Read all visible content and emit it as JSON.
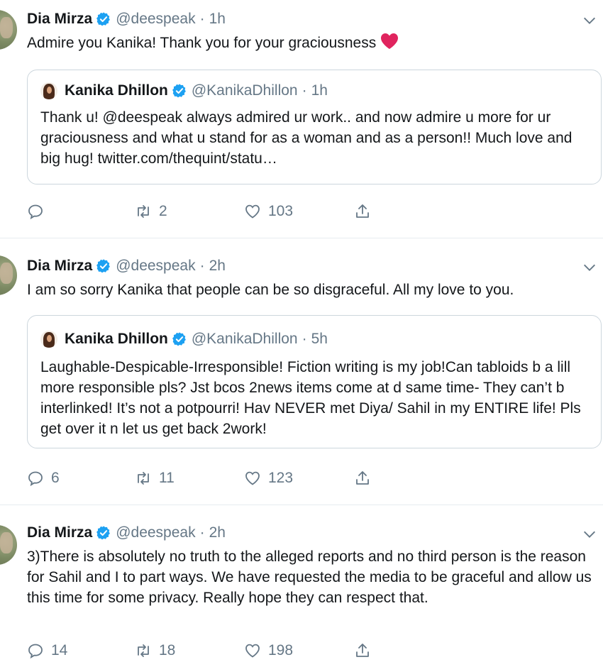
{
  "tweets": [
    {
      "author": {
        "name": "Dia Mirza",
        "handle": "@deespeak"
      },
      "time": "1h",
      "text": "Admire you Kanika! Thank you for your graciousness",
      "emoji": "heart-emoji",
      "quote": {
        "author": {
          "name": "Kanika Dhillon",
          "handle": "@KanikaDhillon"
        },
        "time": "1h",
        "text": "Thank u! @deespeak always admired ur work.. and now admire u more for ur graciousness and what u stand for as a woman and as a person!! Much love and big hug! twitter.com/thequint/statu…"
      },
      "stats": {
        "replies": "",
        "retweets": "2",
        "likes": "103"
      }
    },
    {
      "author": {
        "name": "Dia Mirza",
        "handle": "@deespeak"
      },
      "time": "2h",
      "text": "I am so sorry Kanika that people can be so disgraceful. All my love to you.",
      "quote": {
        "author": {
          "name": "Kanika Dhillon",
          "handle": "@KanikaDhillon"
        },
        "time": "5h",
        "text": "Laughable-Despicable-Irresponsible! Fiction writing is my job!Can tabloids b a lill more responsible pls? Jst bcos 2news items come at d same time- They can’t b interlinked! It’s not a potpourri! Hav NEVER met Diya/ Sahil in my ENTIRE life! Pls get over it n let us get back 2work!"
      },
      "stats": {
        "replies": "6",
        "retweets": "11",
        "likes": "123"
      }
    },
    {
      "author": {
        "name": "Dia Mirza",
        "handle": "@deespeak"
      },
      "time": "2h",
      "text": "3)There is absolutely no truth to the alleged reports and no third person is the reason for Sahil and I to part ways. We have requested the media to be graceful and allow us this time for some privacy. Really hope they can respect that.",
      "stats": {
        "replies": "14",
        "retweets": "18",
        "likes": "198"
      }
    }
  ],
  "separator": "·",
  "colors": {
    "verified": "#1da1f2",
    "muted": "#657786",
    "text": "#14171a",
    "border": "#ccd6dd",
    "heart": "#e0245e"
  }
}
